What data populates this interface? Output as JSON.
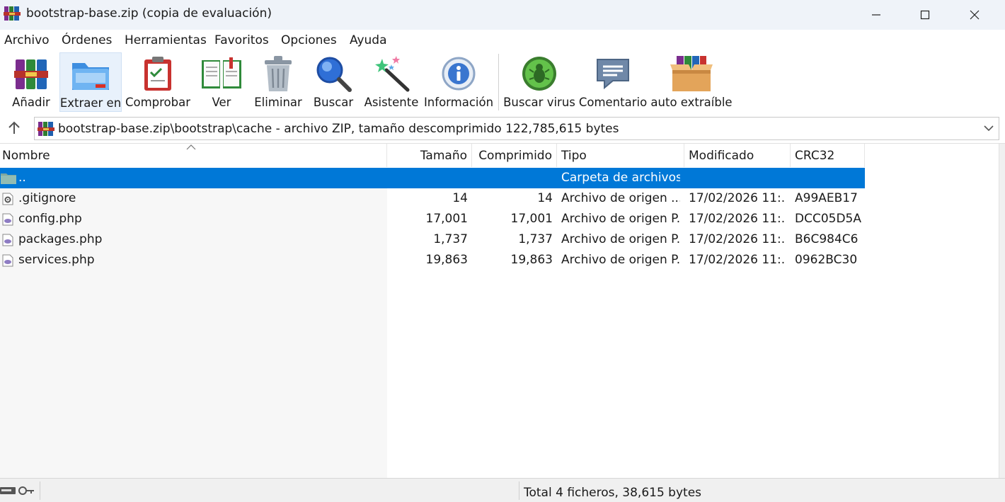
{
  "window": {
    "title": "bootstrap-base.zip (copia de evaluación)",
    "controls": {
      "minimize_icon": "minimize-icon",
      "maximize_icon": "maximize-icon",
      "close_icon": "close-icon"
    }
  },
  "menu": [
    "Archivo",
    "Órdenes",
    "Herramientas",
    "Favoritos",
    "Opciones",
    "Ayuda"
  ],
  "toolbar": [
    {
      "label": "Añadir",
      "icon": "add-archive-icon"
    },
    {
      "label": "Extraer en",
      "icon": "extract-folder-icon",
      "active": true
    },
    {
      "label": "Comprobar",
      "icon": "test-clipboard-icon"
    },
    {
      "label": "Ver",
      "icon": "view-book-icon"
    },
    {
      "label": "Eliminar",
      "icon": "trash-icon"
    },
    {
      "label": "Buscar",
      "icon": "magnifier-icon"
    },
    {
      "label": "Asistente",
      "icon": "wizard-wand-icon"
    },
    {
      "label": "Información",
      "icon": "info-icon"
    },
    {
      "label": "Buscar virus",
      "icon": "virus-scan-icon"
    },
    {
      "label": "Comentario",
      "icon": "comment-icon"
    },
    {
      "label": "auto extraíble",
      "icon": "sfx-box-icon"
    }
  ],
  "address": {
    "path": "bootstrap-base.zip\\bootstrap\\cache - archivo ZIP, tamaño descomprimido 122,785,615 bytes"
  },
  "columns": {
    "name": "Nombre",
    "size": "Tamaño",
    "compressed": "Comprimido",
    "type": "Tipo",
    "modified": "Modificado",
    "crc": "CRC32"
  },
  "rows": [
    {
      "name": "..",
      "size": "",
      "compressed": "",
      "type": "Carpeta de archivos",
      "modified": "",
      "crc": "",
      "icon": "folder-up-icon",
      "selected": true
    },
    {
      "name": ".gitignore",
      "size": "14",
      "compressed": "14",
      "type": "Archivo de origen ...",
      "modified": "17/02/2026 11:...",
      "crc": "A99AEB17",
      "icon": "settings-file-icon"
    },
    {
      "name": "config.php",
      "size": "17,001",
      "compressed": "17,001",
      "type": "Archivo de origen P...",
      "modified": "17/02/2026 11:...",
      "crc": "DCC05D5A",
      "icon": "php-file-icon"
    },
    {
      "name": "packages.php",
      "size": "1,737",
      "compressed": "1,737",
      "type": "Archivo de origen P...",
      "modified": "17/02/2026 11:...",
      "crc": "B6C984C6",
      "icon": "php-file-icon"
    },
    {
      "name": "services.php",
      "size": "19,863",
      "compressed": "19,863",
      "type": "Archivo de origen P...",
      "modified": "17/02/2026 11:...",
      "crc": "0962BC30",
      "icon": "php-file-icon"
    }
  ],
  "status": {
    "total": "Total 4 ficheros, 38,615 bytes"
  },
  "colors": {
    "selection": "#0078d7",
    "titlebar": "#eff3f9"
  }
}
